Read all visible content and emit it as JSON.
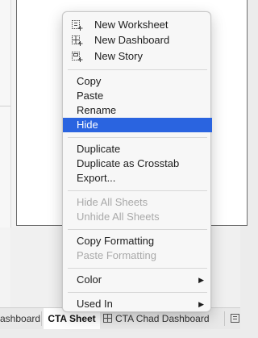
{
  "menu": {
    "items": [
      {
        "label": "New Worksheet",
        "icon": "new-worksheet-icon"
      },
      {
        "label": "New Dashboard",
        "icon": "new-dashboard-icon"
      },
      {
        "label": "New Story",
        "icon": "new-story-icon"
      },
      {
        "label": "Copy"
      },
      {
        "label": "Paste"
      },
      {
        "label": "Rename"
      },
      {
        "label": "Hide",
        "highlighted": true
      },
      {
        "label": "Duplicate"
      },
      {
        "label": "Duplicate as Crosstab"
      },
      {
        "label": "Export..."
      },
      {
        "label": "Hide All Sheets",
        "disabled": true
      },
      {
        "label": "Unhide All Sheets",
        "disabled": true
      },
      {
        "label": "Copy Formatting"
      },
      {
        "label": "Paste Formatting",
        "disabled": true
      },
      {
        "label": "Color",
        "submenu": true,
        "arrow": "▶"
      },
      {
        "label": "Used In",
        "submenu": true,
        "arrow": "▶"
      }
    ]
  },
  "tabs": [
    {
      "label": "ashboard"
    },
    {
      "label": "CTA Sheet",
      "active": true
    },
    {
      "label": "CTA Chad Dashboard",
      "icon": "dashboard-icon"
    },
    {
      "label": "",
      "icon": "sheet-icon"
    }
  ],
  "colors": {
    "highlight": "#2a64e0",
    "disabled_text": "#a9a9a9"
  }
}
